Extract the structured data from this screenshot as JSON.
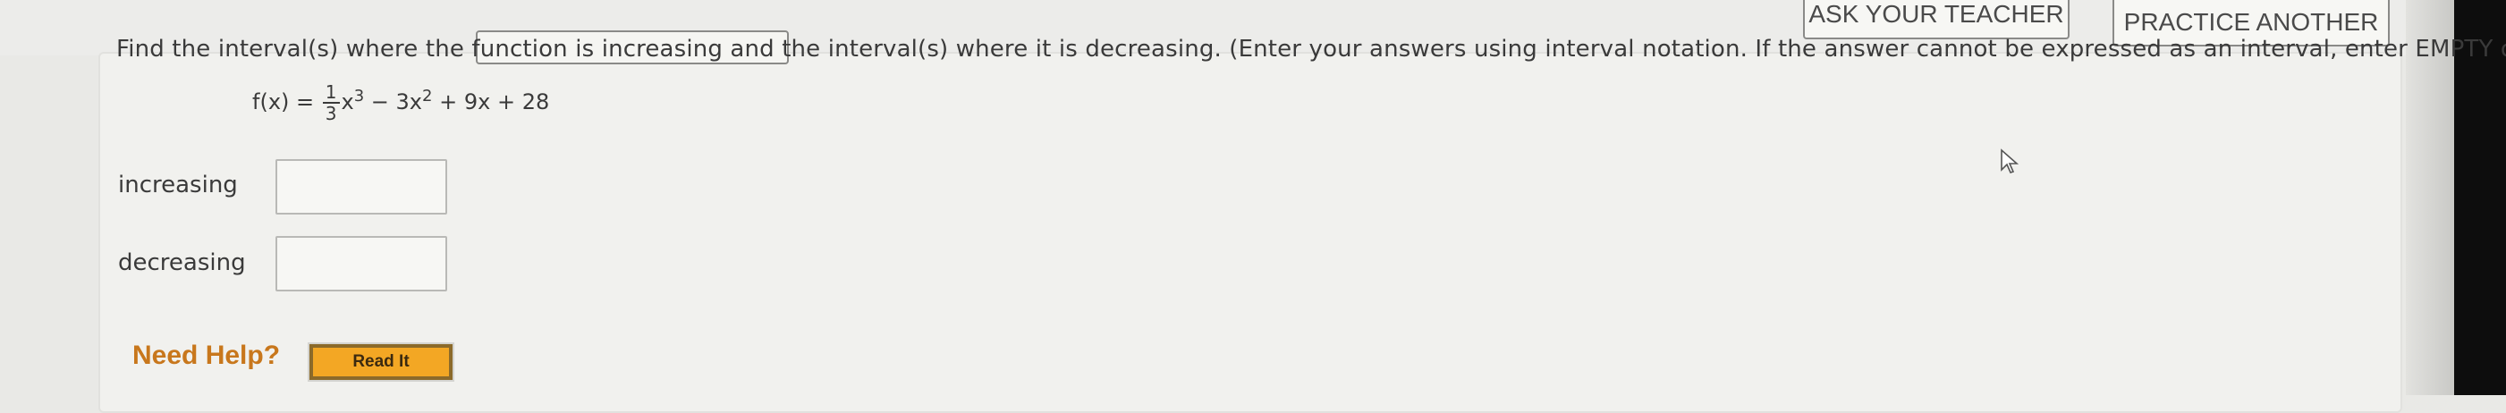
{
  "toolbar": {
    "ask_teacher_label": "ASK YOUR TEACHER",
    "practice_another_label": "PRACTICE ANOTHER"
  },
  "question": {
    "prompt": "Find the interval(s) where the function is increasing and the interval(s) where it is decreasing. (Enter your answers using interval notation. If the answer cannot be expressed as an interval, enter EMPTY or ∅.)",
    "function_lhs": "f(x) =",
    "frac_num": "1",
    "frac_den": "3",
    "term1_var": "x",
    "term1_exp": "3",
    "term2": "− 3x",
    "term2_exp": "2",
    "term3": "+ 9x + 28"
  },
  "answers": {
    "increasing_label": "increasing",
    "increasing_value": "",
    "decreasing_label": "decreasing",
    "decreasing_value": ""
  },
  "help": {
    "label": "Need Help?",
    "read_it_label": "Read It"
  },
  "colors": {
    "accent_orange": "#f3a724",
    "help_text": "#c8771c"
  }
}
